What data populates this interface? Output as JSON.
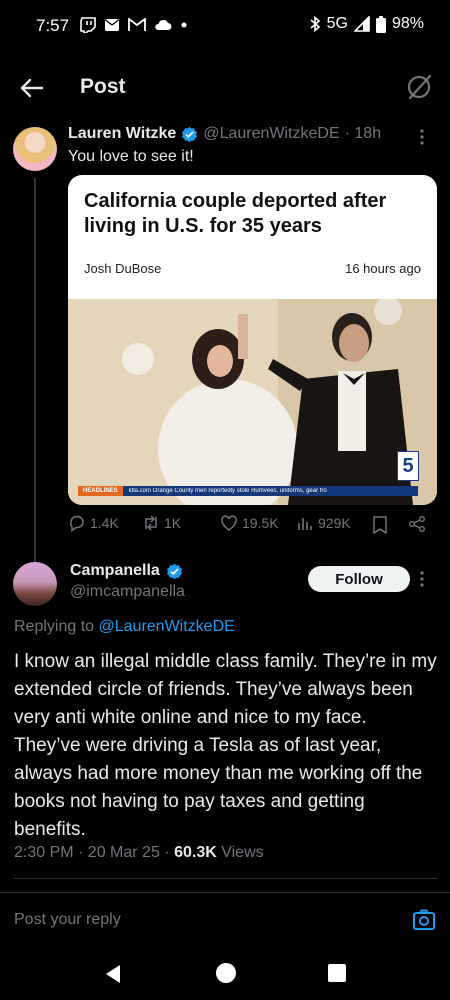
{
  "status_bar": {
    "time": "7:57",
    "network": "5G",
    "battery": "98%"
  },
  "header": {
    "title": "Post"
  },
  "parent_tweet": {
    "author_name": "Lauren Witzke",
    "handle": "@LaurenWitzkeDE",
    "time": "· 18h",
    "text": "You love to see it!",
    "card": {
      "headline": "California couple deported after living in U.S. for 35 years",
      "byline": "Josh DuBose",
      "published": "16 hours ago",
      "ticker_tag": "HEADLINES",
      "ticker_text": "ktla.com   Orange County men reportedly stole Humvees, uniforms, gear fro",
      "station_logo": "5"
    },
    "stats": {
      "replies": "1.4K",
      "reposts": "1K",
      "likes": "19.5K",
      "views": "929K"
    }
  },
  "focal_tweet": {
    "author_name": "Campanella",
    "handle": "@imcampanella",
    "follow_label": "Follow",
    "replying_prefix": "Replying to",
    "replying_to": "@LaurenWitzkeDE",
    "text": "I know an illegal middle class family. They’re in my extended circle of friends. They’ve always been very anti white online and nice to my face. They’ve were driving a Tesla as of last year, always had more money than me working off the books not having to pay taxes and getting benefits.",
    "timestamp": "2:30 PM · 20 Mar 25 ·",
    "views_count": "60.3K",
    "views_label": "Views"
  },
  "reply_box": {
    "placeholder": "Post your reply"
  },
  "colors": {
    "background": "#000000",
    "accent": "#1d9bf0",
    "muted": "#71767b"
  }
}
